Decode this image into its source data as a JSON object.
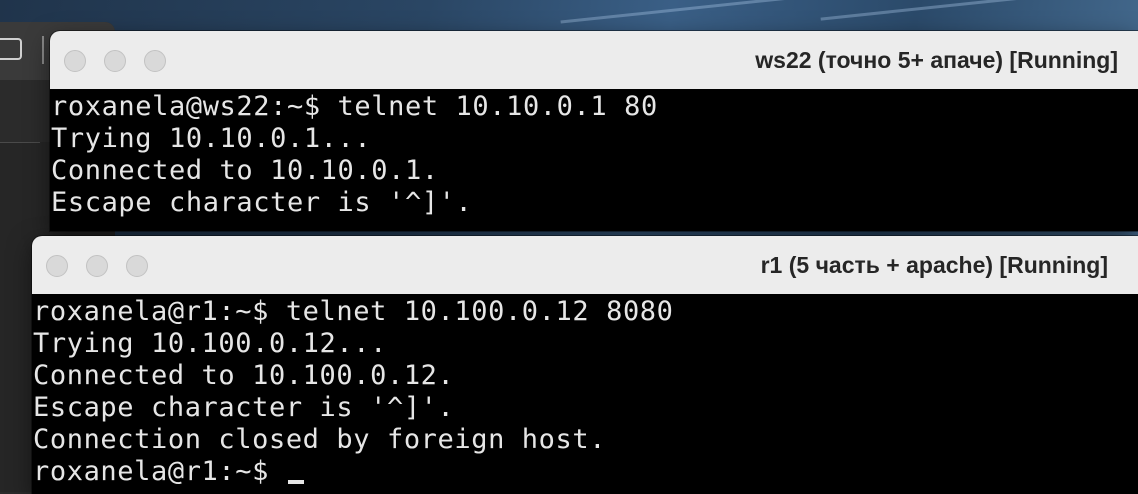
{
  "windows": {
    "ws22": {
      "title": "ws22 (точно 5+ апаче) [Running]",
      "lines": [
        "roxanela@ws22:~$ telnet 10.10.0.1 80",
        "Trying 10.10.0.1...",
        "Connected to 10.10.0.1.",
        "Escape character is '^]'."
      ]
    },
    "r1": {
      "title": "r1 (5 часть + apache) [Running]",
      "lines": [
        "roxanela@r1:~$ telnet 10.100.0.12 8080",
        "Trying 10.100.0.12...",
        "Connected to 10.100.0.12.",
        "Escape character is '^]'.",
        "Connection closed by foreign host.",
        "roxanela@r1:~$ "
      ]
    }
  },
  "colors": {
    "titlebar": "#ececec",
    "console_bg": "#000000",
    "console_fg": "#e6e6e6",
    "traffic_inactive": "#d9d9d9"
  },
  "icons": {
    "window_controls": [
      "close-button-inactive",
      "minimize-button-inactive",
      "zoom-button-inactive"
    ],
    "cursor": "underscore-cursor"
  }
}
